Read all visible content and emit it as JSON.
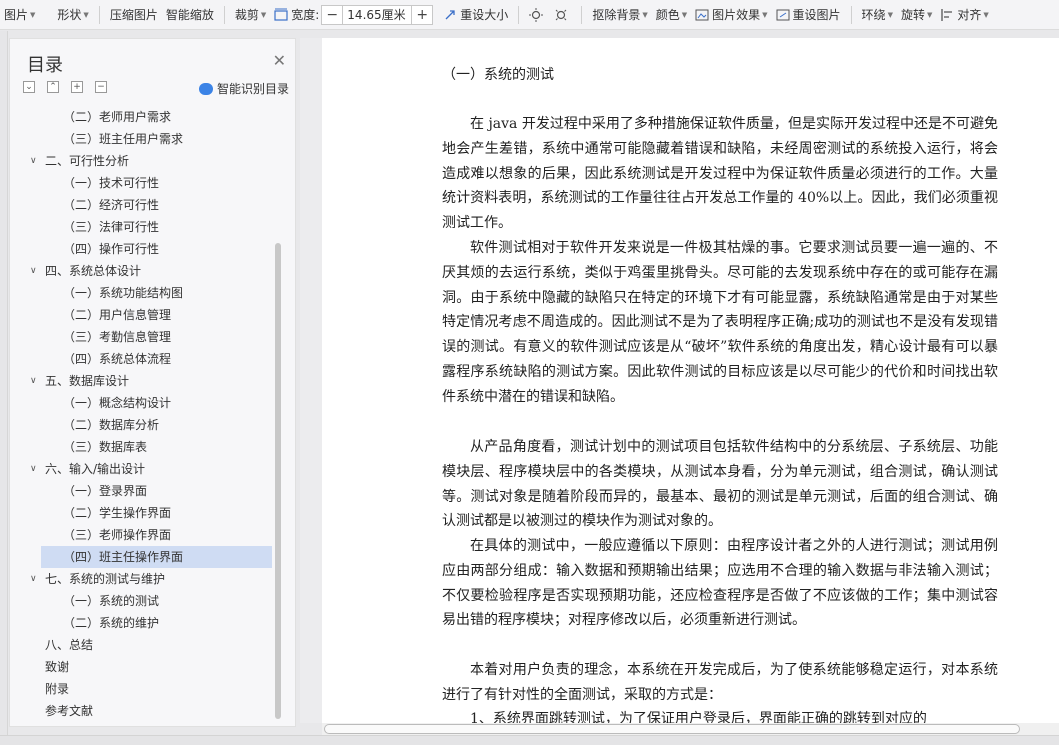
{
  "toolbar": {
    "picture": "图片",
    "shape": "形状",
    "compress": "压缩图片",
    "smart_zoom": "智能缩放",
    "crop": "裁剪",
    "width_label": "宽度:",
    "width_value": "14.65厘米",
    "minus": "−",
    "plus": "+",
    "reset_size": "重设大小",
    "remove_bg": "抠除背景",
    "color": "颜色",
    "effects": "图片效果",
    "reset_picture": "重设图片",
    "wrap": "环绕",
    "rotate": "旋转",
    "align": "对齐"
  },
  "toc": {
    "title": "目录",
    "smart_label": "智能识别目录",
    "items": [
      {
        "label": "（二）老师用户需求",
        "level": 2
      },
      {
        "label": "（三）班主任用户需求",
        "level": 2
      },
      {
        "label": "二、可行性分析",
        "level": 1,
        "expanded": true
      },
      {
        "label": "（一）技术可行性",
        "level": 2
      },
      {
        "label": "（二）经济可行性",
        "level": 2
      },
      {
        "label": "（三）法律可行性",
        "level": 2
      },
      {
        "label": "（四）操作可行性",
        "level": 2
      },
      {
        "label": "四、系统总体设计",
        "level": 1,
        "expanded": true
      },
      {
        "label": "（一）系统功能结构图",
        "level": 2
      },
      {
        "label": "（二）用户信息管理",
        "level": 2
      },
      {
        "label": "（三）考勤信息管理",
        "level": 2
      },
      {
        "label": "（四）系统总体流程",
        "level": 2
      },
      {
        "label": "五、数据库设计",
        "level": 1,
        "expanded": true
      },
      {
        "label": "（一）概念结构设计",
        "level": 2
      },
      {
        "label": "（二）数据库分析",
        "level": 2
      },
      {
        "label": "（三）数据库表",
        "level": 2
      },
      {
        "label": "六、输入/输出设计",
        "level": 1,
        "expanded": true
      },
      {
        "label": "（一）登录界面",
        "level": 2
      },
      {
        "label": "（二）学生操作界面",
        "level": 2
      },
      {
        "label": "（三）老师操作界面",
        "level": 2
      },
      {
        "label": "（四）班主任操作界面",
        "level": 2,
        "selected": true
      },
      {
        "label": "七、系统的测试与维护",
        "level": 1,
        "expanded": true
      },
      {
        "label": "（一）系统的测试",
        "level": 2
      },
      {
        "label": "（二）系统的维护",
        "level": 2
      },
      {
        "label": "八、总结",
        "level": 1
      },
      {
        "label": "致谢",
        "level": 1
      },
      {
        "label": "附录",
        "level": 1
      },
      {
        "label": "参考文献",
        "level": 1
      }
    ]
  },
  "document": {
    "heading": "（一）系统的测试",
    "paragraphs": [
      "在 java 开发过程中采用了多种措施保证软件质量，但是实际开发过程中还是不可避免地会产生差错，系统中通常可能隐藏着错误和缺陷，未经周密测试的系统投入运行，将会造成难以想象的后果，因此系统测试是开发过程中为保证软件质量必须进行的工作。大量统计资料表明，系统测试的工作量往往占开发总工作量的 40%以上。因此，我们必须重视测试工作。",
      "软件测试相对于软件开发来说是一件极其枯燥的事。它要求测试员要一遍一遍的、不厌其烦的去运行系统，类似于鸡蛋里挑骨头。尽可能的去发现系统中存在的或可能存在漏洞。由于系统中隐藏的缺陷只在特定的环境下才有可能显露，系统缺陷通常是由于对某些特定情况考虑不周造成的。因此测试不是为了表明程序正确;成功的测试也不是没有发现错误的测试。有意义的软件测试应该是从“破坏”软件系统的角度出发，精心设计最有可以暴露程序系统缺陷的测试方案。因此软件测试的目标应该是以尽可能少的代价和时间找出软件系统中潜在的错误和缺陷。",
      "从产品角度看，测试计划中的测试项目包括软件结构中的分系统层、子系统层、功能模块层、程序模块层中的各类模块，从测试本身看，分为单元测试，组合测试，确认测试等。测试对象是随着阶段而异的，最基本、最初的测试是单元测试，后面的组合测试、确认测试都是以被测过的模块作为测试对象的。",
      "在具体的测试中，一般应遵循以下原则：由程序设计者之外的人进行测试；测试用例应由两部分组成：输入数据和预期输出结果；应选用不合理的输入数据与非法输入测试；不仅要检验程序是否实现预期功能，还应检查程序是否做了不应该做的工作；集中测试容易出错的程序模块；对程序修改以后，必须重新进行测试。",
      "本着对用户负责的理念，本系统在开发完成后，为了使系统能够稳定运行，对本系统进行了有针对性的全面测试，采取的方式是：",
      "1、系统界面跳转测试，为了保证用户登录后，界面能正确的跳转到对应的"
    ]
  },
  "colors": {
    "accent": "#3b83e6",
    "selection": "#cfdcf3"
  }
}
